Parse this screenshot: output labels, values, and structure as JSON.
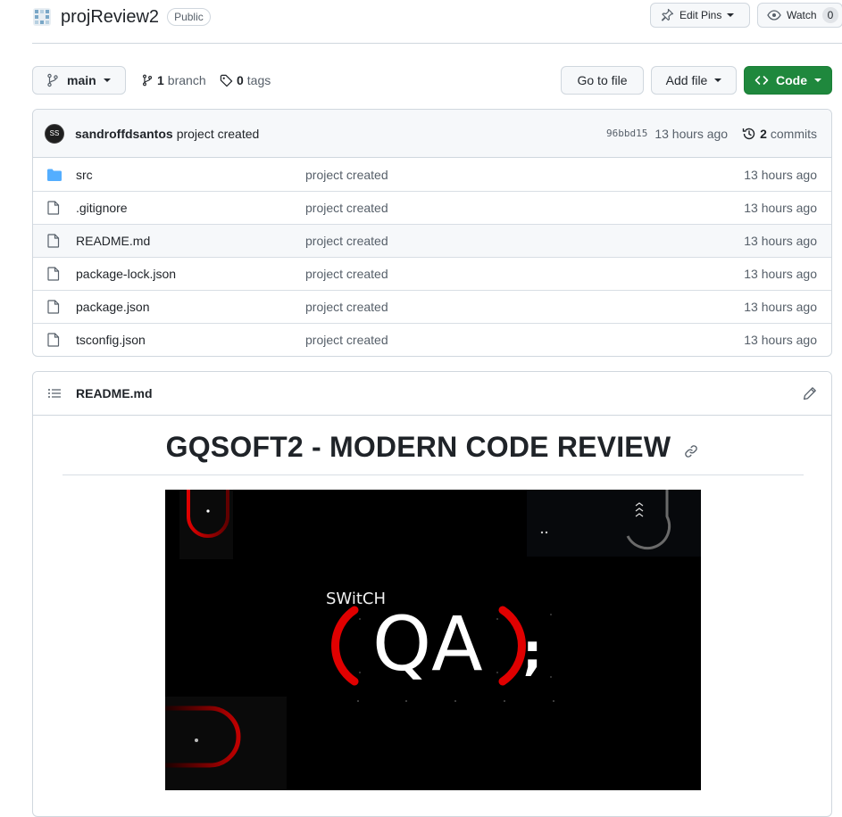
{
  "repo": {
    "name": "projReview2",
    "visibility": "Public"
  },
  "header_actions": {
    "edit_pins": "Edit Pins",
    "watch": "Watch",
    "watch_count": "0"
  },
  "branch_bar": {
    "branch": "main",
    "branch_count": "1",
    "branch_label": "branch",
    "tag_count": "0",
    "tag_label": "tags",
    "go_to_file": "Go to file",
    "add_file": "Add file",
    "code": "Code"
  },
  "latest_commit": {
    "avatar_text": "SS",
    "author": "sandroffdsantos",
    "message": "project created",
    "sha": "96bbd15",
    "time": "13 hours ago",
    "commit_count": "2",
    "commit_label": "commits"
  },
  "files": [
    {
      "type": "folder",
      "icon": "folder-icon",
      "name": "src",
      "message": "project created",
      "time": "13 hours ago"
    },
    {
      "type": "file",
      "icon": "file-icon",
      "name": ".gitignore",
      "message": "project created",
      "time": "13 hours ago"
    },
    {
      "type": "file",
      "icon": "file-icon",
      "name": "README.md",
      "message": "project created",
      "time": "13 hours ago"
    },
    {
      "type": "file",
      "icon": "file-icon",
      "name": "package-lock.json",
      "message": "project created",
      "time": "13 hours ago"
    },
    {
      "type": "file",
      "icon": "file-icon",
      "name": "package.json",
      "message": "project created",
      "time": "13 hours ago"
    },
    {
      "type": "file",
      "icon": "file-icon",
      "name": "tsconfig.json",
      "message": "project created",
      "time": "13 hours ago"
    }
  ],
  "readme": {
    "filename": "README.md",
    "heading": "GQSOFT2 - MODERN CODE REVIEW",
    "banner": {
      "top_text": "SWitCH",
      "main_text": "QA",
      "suffix": ";"
    }
  },
  "colors": {
    "accent_green": "#1f883d",
    "folder_blue": "#54aeff",
    "banner_red": "#e00000"
  }
}
